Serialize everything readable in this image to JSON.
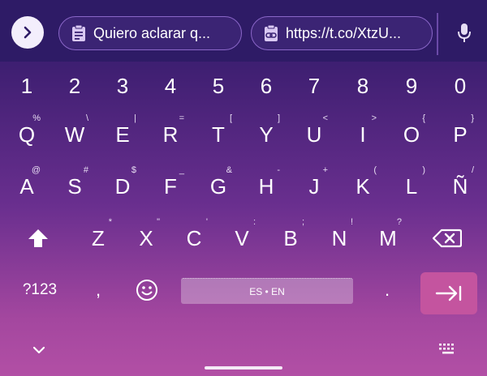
{
  "suggestions": {
    "chip1": {
      "text": "Quiero aclarar q...",
      "icon": "clipboard-icon"
    },
    "chip2": {
      "text": "https://t.co/XtzU...",
      "icon": "clipboard-link-icon"
    }
  },
  "number_row": [
    "1",
    "2",
    "3",
    "4",
    "5",
    "6",
    "7",
    "8",
    "9",
    "0"
  ],
  "row1": {
    "keys": [
      "Q",
      "W",
      "E",
      "R",
      "T",
      "Y",
      "U",
      "I",
      "O",
      "P"
    ],
    "hints": [
      "%",
      "\\",
      "|",
      "=",
      "[",
      "]",
      "<",
      ">",
      "{",
      "}"
    ]
  },
  "row2": {
    "keys": [
      "A",
      "S",
      "D",
      "F",
      "G",
      "H",
      "J",
      "K",
      "L",
      "Ñ"
    ],
    "hints": [
      "@",
      "#",
      "$",
      "_",
      "&",
      "-",
      "+",
      "(",
      ")",
      "/"
    ]
  },
  "row3": {
    "keys": [
      "Z",
      "X",
      "C",
      "V",
      "B",
      "N",
      "M"
    ],
    "hints": [
      "*",
      "\"",
      "'",
      ":",
      ";",
      "!",
      "?"
    ]
  },
  "bottom_row": {
    "symbols_label": "?123",
    "comma": ",",
    "space_label": "ES • EN",
    "period": "."
  },
  "colors": {
    "accent_enter": "#c4549f",
    "suggest_bar": "#2e1b66"
  }
}
